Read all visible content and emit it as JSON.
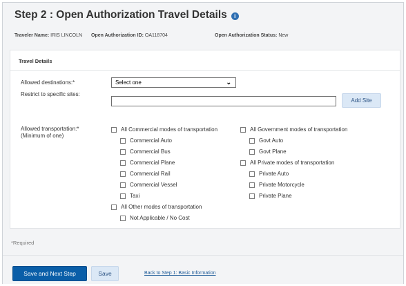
{
  "header": {
    "title": "Step 2 : Open Authorization Travel Details",
    "help_icon": "i",
    "traveler_name_label": "Traveler Name:",
    "traveler_name_value": "IRIS LINCOLN",
    "oa_id_label": "Open Authorization ID:",
    "oa_id_value": "OA118704",
    "oa_status_label": "Open Authorization Status:",
    "oa_status_value": "New"
  },
  "travel_details": {
    "section_title": "Travel Details",
    "allowed_destinations_label": "Allowed destinations:*",
    "allowed_destinations_value": "Select one",
    "restrict_sites_label": "Restrict to specific sites:",
    "restrict_sites_value": "",
    "add_site_label": "Add Site",
    "allowed_transportation_label": "Allowed transportation:*",
    "allowed_transportation_note": "(Minimum of one)",
    "commercial_all": "All Commercial modes of transportation",
    "commercial_items": [
      "Commercial Auto",
      "Commercial Bus",
      "Commercial Plane",
      "Commercial Rail",
      "Commercial Vessel",
      "Taxi"
    ],
    "other_all": "All Other modes of transportation",
    "other_items": [
      "Not Applicable / No Cost"
    ],
    "government_all": "All Government modes of transportation",
    "government_items": [
      "Govt Auto",
      "Govt Plane"
    ],
    "private_all": "All Private modes of transportation",
    "private_items": [
      "Private Auto",
      "Private Motorcycle",
      "Private Plane"
    ]
  },
  "required_note": "*Required",
  "footer": {
    "save_next_label": "Save and Next Step",
    "save_label": "Save",
    "back_link": "Back to Step 1: Basic Information"
  },
  "colors": {
    "primary": "#0a5ea8",
    "secondary": "#dbe8f6",
    "link": "#1f5c99"
  }
}
